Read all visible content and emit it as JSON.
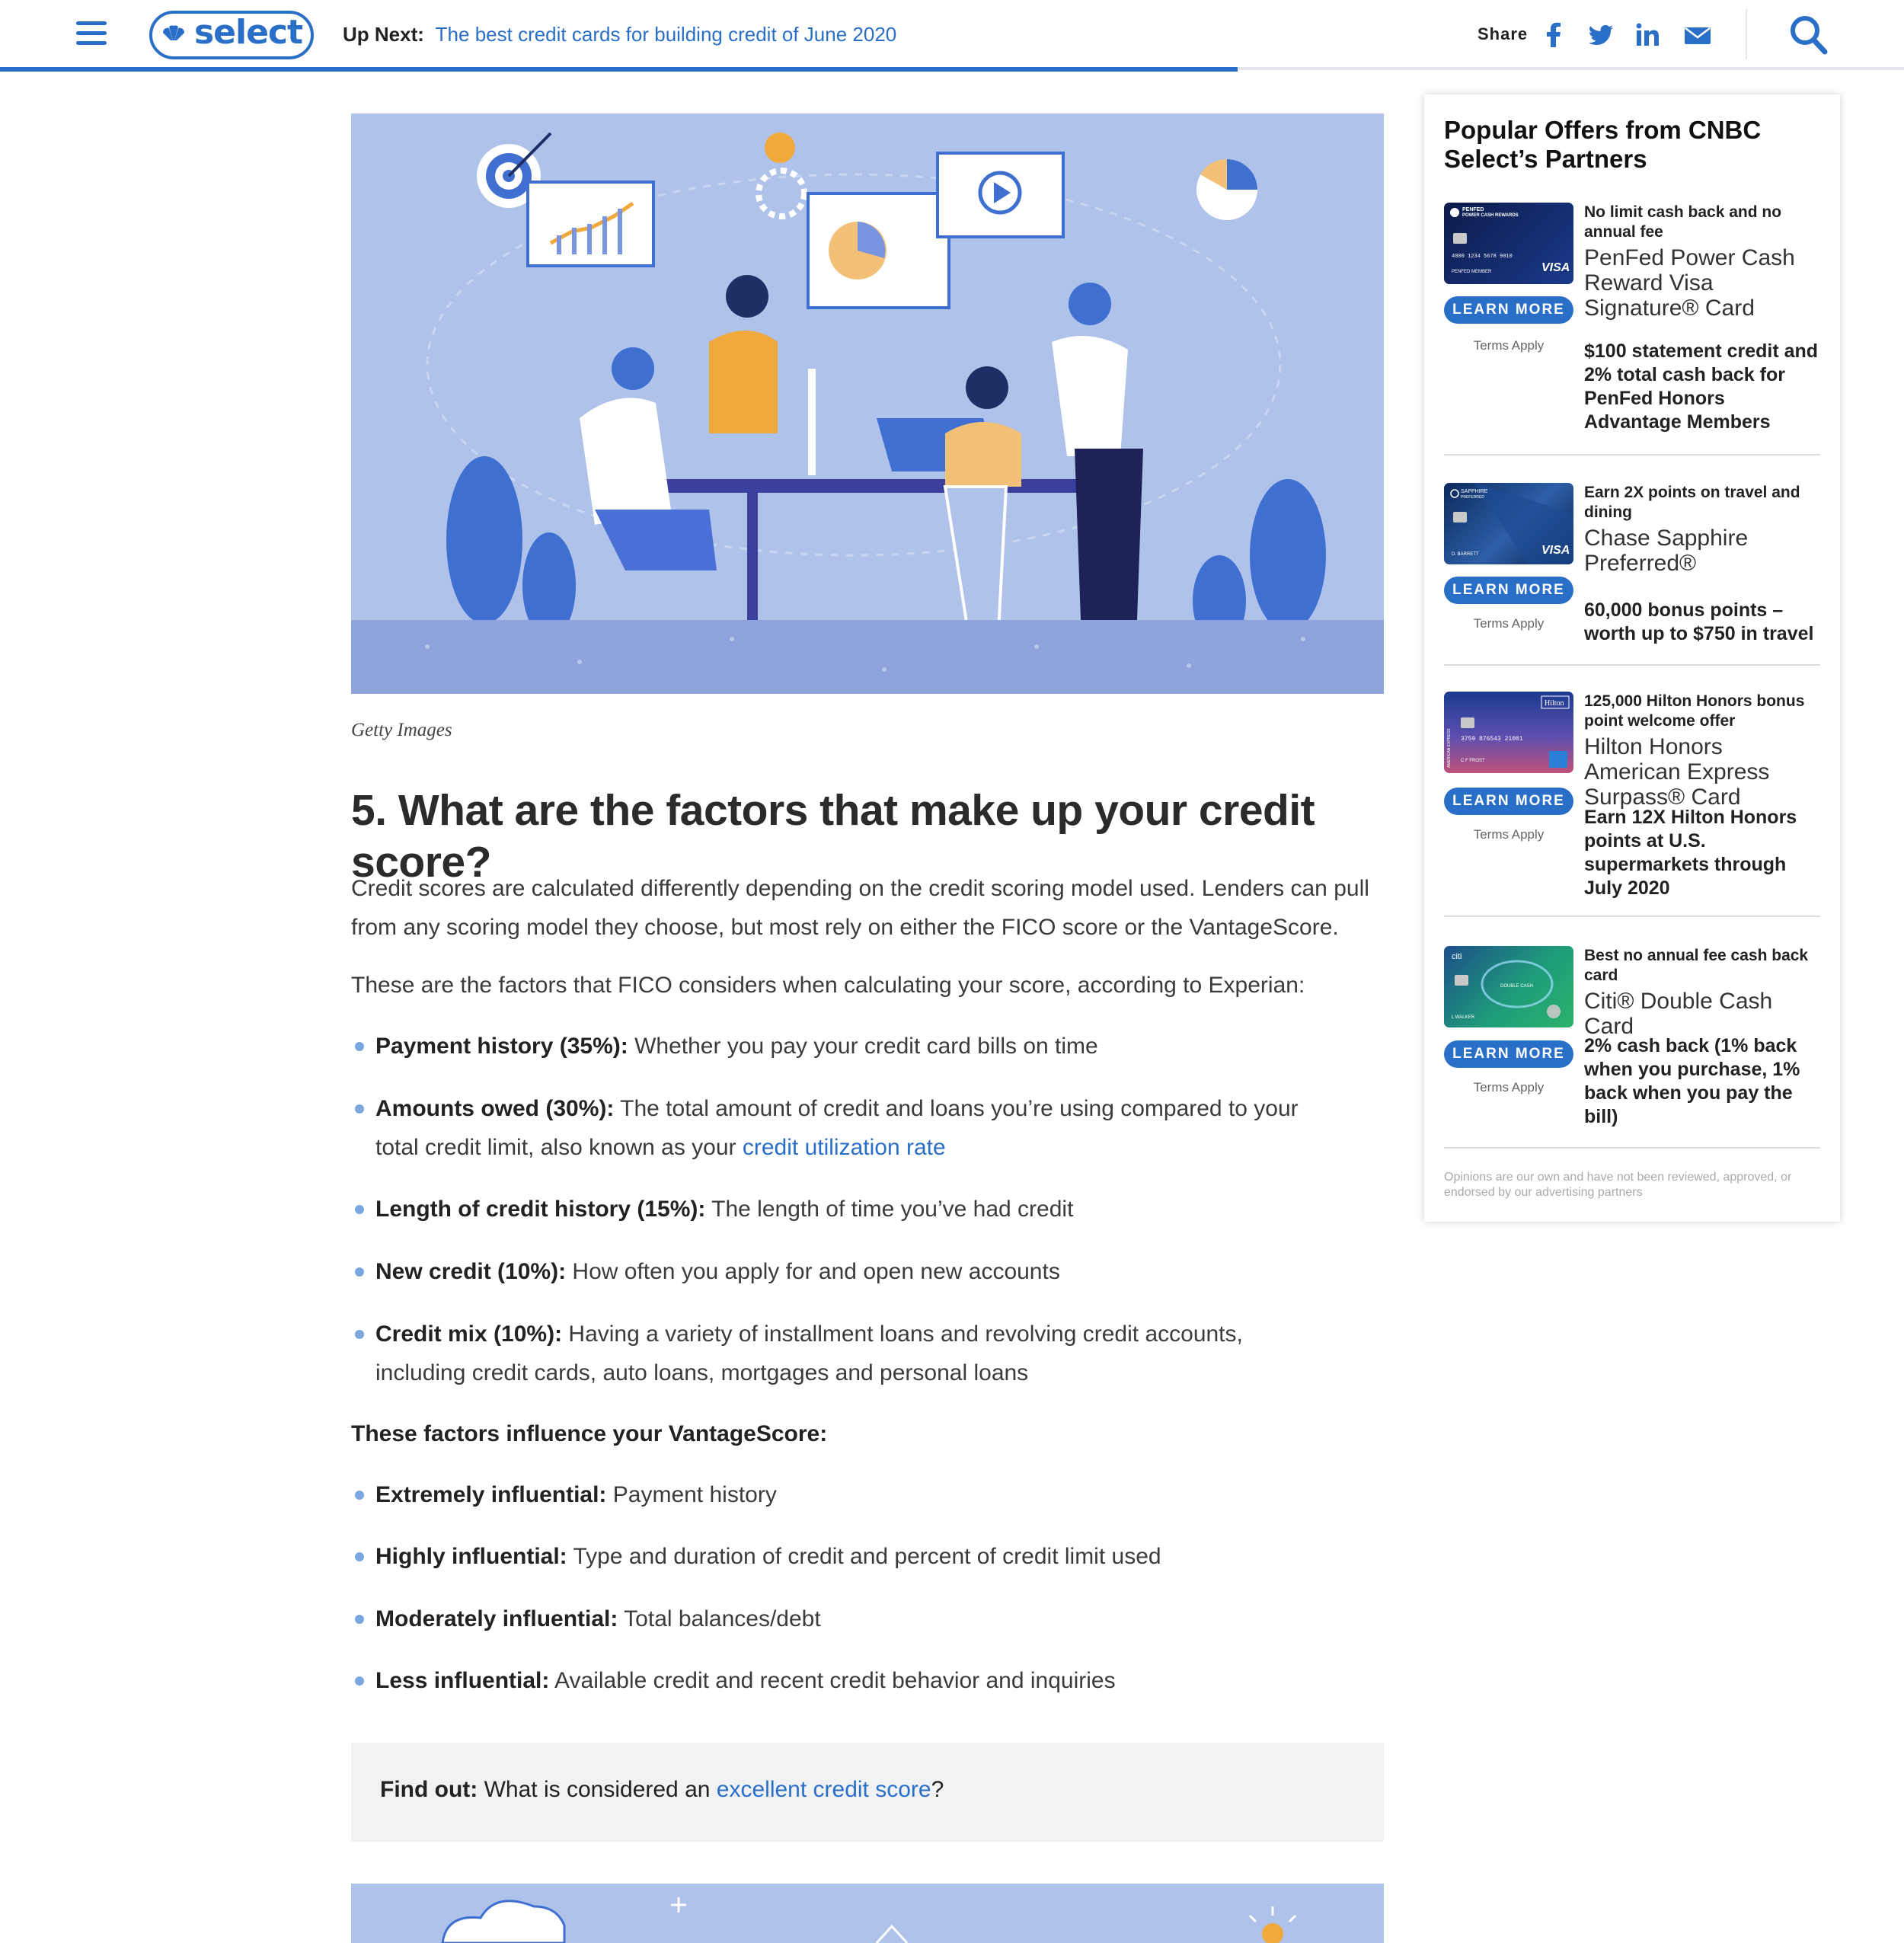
{
  "header": {
    "logo_text": "select",
    "up_next_label": "Up Next:",
    "up_next_link": "The best credit cards for building credit of June 2020",
    "share_label": "Share",
    "reading_progress": 0.65,
    "icons": [
      "menu-icon",
      "facebook-icon",
      "twitter-icon",
      "linkedin-icon",
      "email-icon",
      "search-icon"
    ]
  },
  "article": {
    "image_caption": "Getty Images",
    "heading": "5. What are the factors that make up your credit score?",
    "intro_paragraph": "Credit scores are calculated differently depending on the credit scoring model used. Lenders can pull from any scoring model they choose, but most rely on either the FICO score or the VantageScore.",
    "fico_intro": "These are the factors that FICO considers when calculating your score, according to Experian:",
    "fico_factors": [
      {
        "label": "Payment history (35%):",
        "text": " Whether you pay your credit card bills on time"
      },
      {
        "label": "Amounts owed (30%):",
        "text": " The total amount of credit and loans you’re using compared to your total credit limit, also known as your ",
        "link": "credit utilization rate"
      },
      {
        "label": "Length of credit history (15%):",
        "text": " The length of time you’ve had credit"
      },
      {
        "label": "New credit (10%):",
        "text": " How often you apply for and open new accounts"
      },
      {
        "label": "Credit mix (10%):",
        "text": " Having a variety of installment loans and revolving credit accounts, including credit cards, auto loans, mortgages and personal loans"
      }
    ],
    "vantage_intro": "These factors influence your VantageScore:",
    "vantage_factors": [
      {
        "label": "Extremely influential:",
        "text": " Payment history"
      },
      {
        "label": "Highly influential:",
        "text": " Type and duration of credit and percent of credit limit used"
      },
      {
        "label": "Moderately influential:",
        "text": " Total balances/debt"
      },
      {
        "label": "Less influential:",
        "text": " Available credit and recent credit behavior and inquiries"
      }
    ],
    "find_out": {
      "label": "Find out:",
      "text": " What is considered an ",
      "link": "excellent credit score",
      "suffix": "?"
    }
  },
  "sidebar": {
    "title": "Popular Offers from CNBC Select’s Partners",
    "learn_more_label": "LEARN MORE",
    "terms_label": "Terms Apply",
    "offers": [
      {
        "tag": "No limit cash back and no annual fee",
        "name": "PenFed Power Cash Reward Visa Signature® Card",
        "bonus": "$100 statement credit and 2% total cash back for PenFed Honors Advantage Members"
      },
      {
        "tag": "Earn 2X points on travel and dining",
        "name": "Chase Sapphire Preferred®",
        "bonus": "60,000 bonus points – worth up to $750 in travel"
      },
      {
        "tag": "125,000 Hilton Honors bonus point welcome offer",
        "name": "Hilton Honors American Express Surpass® Card",
        "bonus": "Earn 12X Hilton Honors points at U.S. supermarkets through July 2020"
      },
      {
        "tag": "Best no annual fee cash back card",
        "name": "Citi® Double Cash Card",
        "bonus": "2% cash back (1% back when you purchase, 1% back when you pay the bill)"
      }
    ],
    "cards": [
      {
        "brand": "PENFED",
        "sub": "POWER CASH REWARDS",
        "number": "4000 1234 5678 9010",
        "holder": "PENFED MEMBER",
        "network": "VISA"
      },
      {
        "brand": "SAPPHIRE",
        "sub": "PREFERRED",
        "holder": "D. BARRETT",
        "network": "VISA"
      },
      {
        "brand": "Hilton",
        "sub": "AMERICAN EXPRESS",
        "number": "3759 876543 21001",
        "holder": "C F FROST"
      },
      {
        "brand": "citi",
        "sub": "DOUBLE CASH",
        "holder": "L WALKER"
      }
    ],
    "disclaimer": "Opinions are our own and have not been reviewed, approved, or endorsed by our advertising partners"
  },
  "colors": {
    "accent": "#2a6fc7",
    "bullet": "#79a7e0",
    "illustration_bg": "#aec2ea"
  }
}
